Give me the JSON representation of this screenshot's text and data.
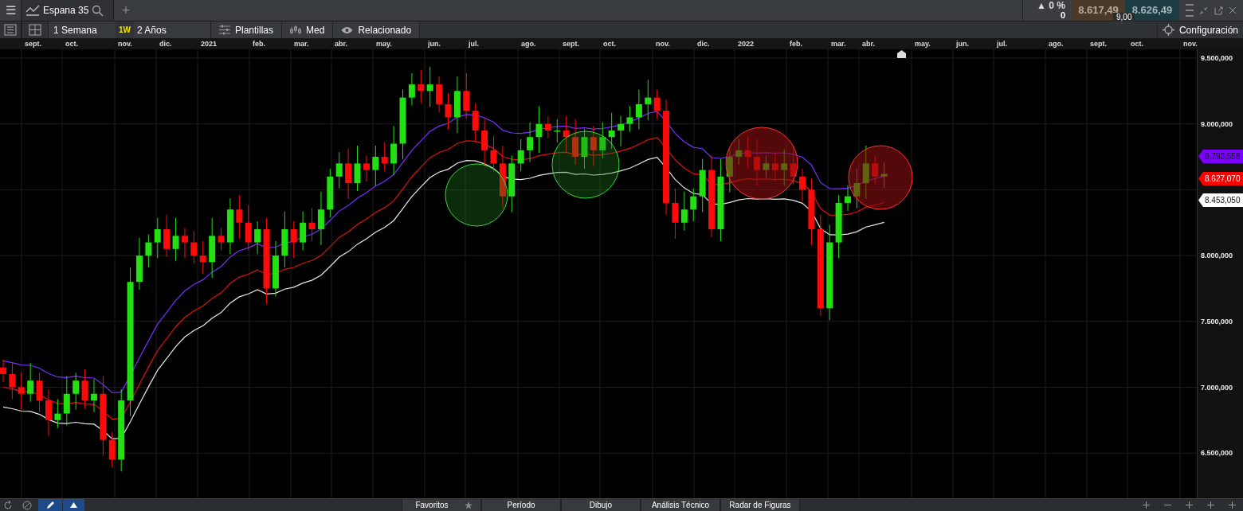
{
  "top_bar": {
    "menu": "☰",
    "tab_title": "Espana 35",
    "add": "+",
    "change_arrow": "▲",
    "change": "0 %",
    "volume": "0",
    "bid": "8.617,49",
    "ask": "8.626,49",
    "spread": "9,00"
  },
  "toolbar": {
    "period": "1 Semana",
    "interval_badge": "1W",
    "range": "2 Años",
    "buttons": [
      {
        "kind": "templates",
        "label": "Plantillas"
      },
      {
        "kind": "measure",
        "label": "Med"
      },
      {
        "kind": "related",
        "label": "Relacionado"
      }
    ],
    "settings": "Configuración"
  },
  "chart": {
    "x_labels": [
      "sept.",
      "oct.",
      "nov.",
      "dic.",
      "2021",
      "feb.",
      "mar.",
      "abr.",
      "may.",
      "jun.",
      "jul.",
      "ago.",
      "sept.",
      "oct.",
      "nov.",
      "dic.",
      "2022",
      "feb.",
      "mar.",
      "abr.",
      "may.",
      "jun.",
      "jul.",
      "ago.",
      "sept.",
      "oct.",
      "nov."
    ],
    "y_labels": [
      "9.500,000",
      "9.000,000",
      "8.000,000",
      "7.500,000",
      "7.000,000",
      "6.500,000"
    ],
    "price_tags": [
      {
        "label": "8.793,558",
        "color": "#7b00ff"
      },
      {
        "label": "8.627,070",
        "color": "#ff0000"
      },
      {
        "label": "8.453,050",
        "color": "#ffffff"
      }
    ]
  },
  "bottom_tabs": [
    "Favoritos",
    "Período",
    "Dibujo",
    "Análisis Técnico",
    "Radar de Figuras"
  ]
}
